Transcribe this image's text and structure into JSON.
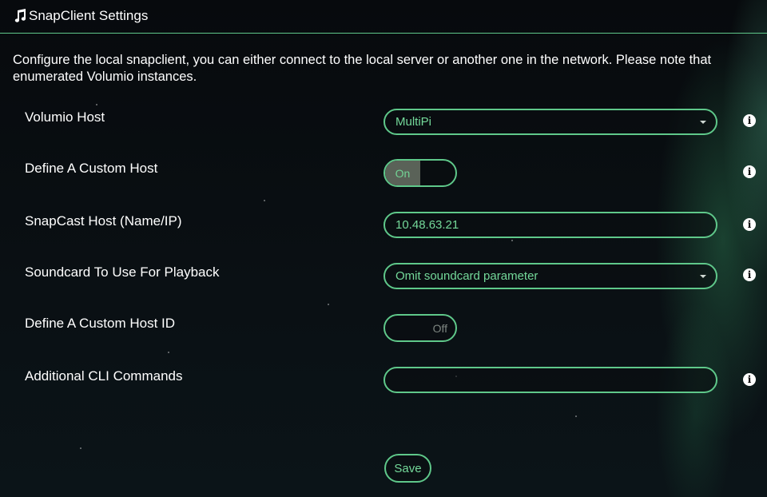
{
  "header": {
    "title": "SnapClient Settings",
    "icon": "music-note-icon"
  },
  "description": {
    "line1": "Configure the local snapclient, you can either connect to the local server or another one in the network. Please note that",
    "line2": "enumerated Volumio instances."
  },
  "settings": [
    {
      "label": "Volumio Host",
      "type": "select",
      "value": "MultiPi"
    },
    {
      "label": "Define A Custom Host",
      "type": "toggle",
      "value": "On"
    },
    {
      "label": "SnapCast Host (Name/IP)",
      "type": "text",
      "value": "10.48.63.21"
    },
    {
      "label": "Soundcard To Use For Playback",
      "type": "select",
      "value": "Omit soundcard parameter"
    },
    {
      "label": "Define A Custom Host ID",
      "type": "toggle",
      "value": "Off"
    },
    {
      "label": "Additional CLI Commands",
      "type": "text",
      "value": ""
    }
  ],
  "info_icon": "i",
  "save_label": "Save",
  "colors": {
    "accent": "#5fc88a",
    "accent_text": "#74d99a",
    "background": "#06090c"
  }
}
